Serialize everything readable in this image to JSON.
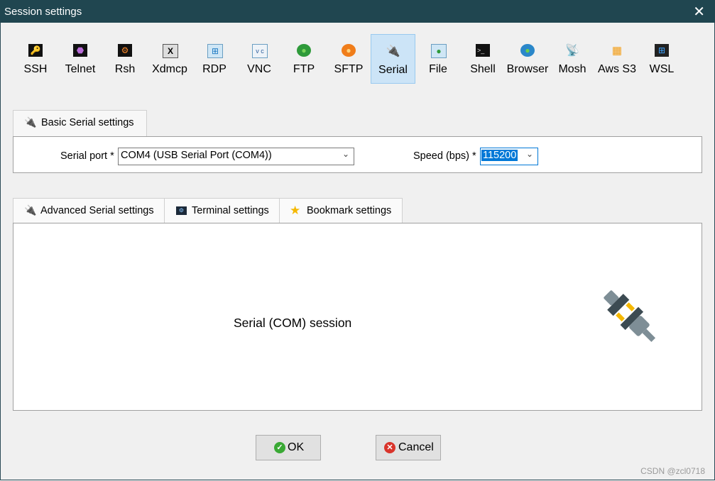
{
  "window": {
    "title": "Session settings"
  },
  "protocols": [
    {
      "label": "SSH",
      "icon": "key-icon"
    },
    {
      "label": "Telnet",
      "icon": "telnet-icon"
    },
    {
      "label": "Rsh",
      "icon": "rsh-icon"
    },
    {
      "label": "Xdmcp",
      "icon": "xdmcp-icon"
    },
    {
      "label": "RDP",
      "icon": "windows-monitor-icon"
    },
    {
      "label": "VNC",
      "icon": "vnc-monitor-icon"
    },
    {
      "label": "FTP",
      "icon": "green-globe-icon"
    },
    {
      "label": "SFTP",
      "icon": "orange-globe-icon"
    },
    {
      "label": "Serial",
      "icon": "plug-icon",
      "selected": true
    },
    {
      "label": "File",
      "icon": "file-monitor-icon"
    },
    {
      "label": "Shell",
      "icon": "terminal-icon"
    },
    {
      "label": "Browser",
      "icon": "globe-icon"
    },
    {
      "label": "Mosh",
      "icon": "satellite-icon"
    },
    {
      "label": "Aws S3",
      "icon": "aws-cubes-icon"
    },
    {
      "label": "WSL",
      "icon": "windows-logo-icon"
    }
  ],
  "basic_tab": {
    "label": "Basic Serial settings"
  },
  "serial_port": {
    "label": "Serial port *",
    "value": "COM4  (USB Serial Port (COM4))"
  },
  "speed": {
    "label": "Speed (bps) *",
    "value": "115200"
  },
  "tabs": [
    {
      "label": "Advanced Serial settings",
      "icon": "plug-icon"
    },
    {
      "label": "Terminal settings",
      "icon": "terminal-settings-icon"
    },
    {
      "label": "Bookmark settings",
      "icon": "star-icon"
    }
  ],
  "session": {
    "title": "Serial (COM) session"
  },
  "buttons": {
    "ok": "OK",
    "cancel": "Cancel"
  },
  "watermark": "CSDN @zcl0718",
  "colors": {
    "titlebar": "#204650",
    "selected_bg": "#cce4f7",
    "focus": "#0078d7"
  }
}
